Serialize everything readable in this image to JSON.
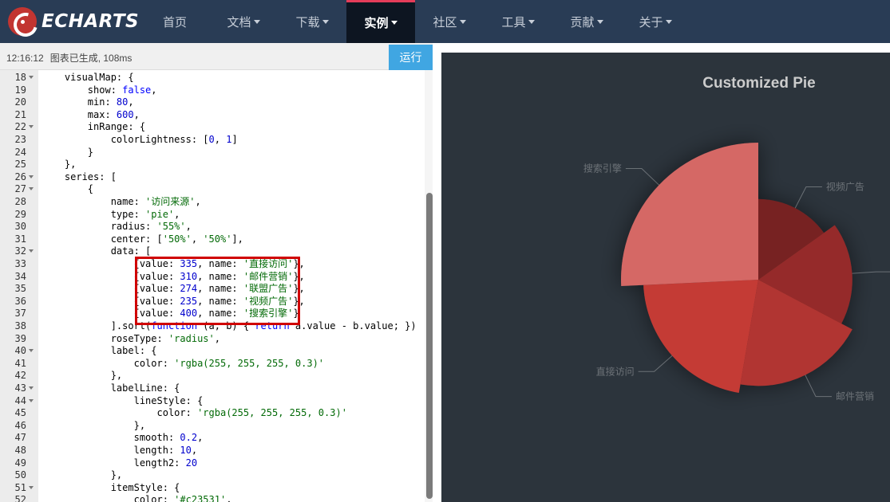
{
  "nav": {
    "logo_text": "ECHARTS",
    "items": [
      {
        "label": "首页"
      },
      {
        "label": "文档"
      },
      {
        "label": "下载"
      },
      {
        "label": "实例"
      },
      {
        "label": "社区"
      },
      {
        "label": "工具"
      },
      {
        "label": "贡献"
      },
      {
        "label": "关于"
      }
    ],
    "active_color": "#e43c59"
  },
  "toolbar": {
    "time": "12:16:12",
    "status": "图表已生成, 108ms",
    "run_label": "运行"
  },
  "editor": {
    "lines": [
      {
        "n": "18",
        "fold": true,
        "code": "    visualMap: {"
      },
      {
        "n": "19",
        "fold": false,
        "code": "        show: false,"
      },
      {
        "n": "20",
        "fold": false,
        "code": "        min: 80,"
      },
      {
        "n": "21",
        "fold": false,
        "code": "        max: 600,"
      },
      {
        "n": "22",
        "fold": true,
        "code": "        inRange: {"
      },
      {
        "n": "23",
        "fold": false,
        "code": "            colorLightness: [0, 1]"
      },
      {
        "n": "24",
        "fold": false,
        "code": "        }"
      },
      {
        "n": "25",
        "fold": false,
        "code": "    },"
      },
      {
        "n": "26",
        "fold": true,
        "code": "    series: ["
      },
      {
        "n": "27",
        "fold": true,
        "code": "        {"
      },
      {
        "n": "28",
        "fold": false,
        "code": "            name: '访问来源',"
      },
      {
        "n": "29",
        "fold": false,
        "code": "            type: 'pie',"
      },
      {
        "n": "30",
        "fold": false,
        "code": "            radius: '55%',"
      },
      {
        "n": "31",
        "fold": false,
        "code": "            center: ['50%', '50%'],"
      },
      {
        "n": "32",
        "fold": true,
        "code": "            data: ["
      },
      {
        "n": "33",
        "fold": false,
        "code": "                {value: 335, name: '直接访问'},"
      },
      {
        "n": "34",
        "fold": false,
        "code": "                {value: 310, name: '邮件营销'},"
      },
      {
        "n": "35",
        "fold": false,
        "code": "                {value: 274, name: '联盟广告'},"
      },
      {
        "n": "36",
        "fold": false,
        "code": "                {value: 235, name: '视频广告'},"
      },
      {
        "n": "37",
        "fold": false,
        "code": "                {value: 400, name: '搜索引擎'}"
      },
      {
        "n": "38",
        "fold": false,
        "code": "            ].sort(function (a, b) { return a.value - b.value; })"
      },
      {
        "n": "39",
        "fold": false,
        "code": "            roseType: 'radius',"
      },
      {
        "n": "40",
        "fold": true,
        "code": "            label: {"
      },
      {
        "n": "41",
        "fold": false,
        "code": "                color: 'rgba(255, 255, 255, 0.3)'"
      },
      {
        "n": "42",
        "fold": false,
        "code": "            },"
      },
      {
        "n": "43",
        "fold": true,
        "code": "            labelLine: {"
      },
      {
        "n": "44",
        "fold": true,
        "code": "                lineStyle: {"
      },
      {
        "n": "45",
        "fold": false,
        "code": "                    color: 'rgba(255, 255, 255, 0.3)'"
      },
      {
        "n": "46",
        "fold": false,
        "code": "                },"
      },
      {
        "n": "47",
        "fold": false,
        "code": "                smooth: 0.2,"
      },
      {
        "n": "48",
        "fold": false,
        "code": "                length: 10,"
      },
      {
        "n": "49",
        "fold": false,
        "code": "                length2: 20"
      },
      {
        "n": "50",
        "fold": false,
        "code": "            },"
      },
      {
        "n": "51",
        "fold": true,
        "code": "            itemStyle: {"
      },
      {
        "n": "52",
        "fold": false,
        "code": "                color: '#c23531',"
      }
    ]
  },
  "chart_data": {
    "type": "pie",
    "rose_type": "radius",
    "title": "Customized Pie",
    "series_name": "访问来源",
    "slices": [
      {
        "name": "视频广告",
        "value": 235
      },
      {
        "name": "联盟广告",
        "value": 274
      },
      {
        "name": "邮件营销",
        "value": 310
      },
      {
        "name": "直接访问",
        "value": 335
      },
      {
        "name": "搜索引擎",
        "value": 400
      }
    ],
    "visual_map": {
      "min": 80,
      "max": 600
    },
    "base_color": "#c23531",
    "background": "#2c343c"
  }
}
